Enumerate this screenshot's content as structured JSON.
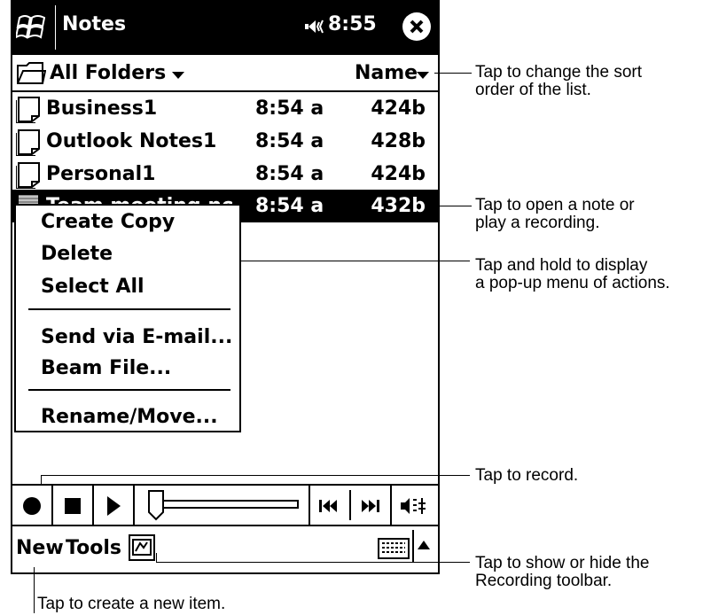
{
  "titlebar": {
    "app_title": "Notes",
    "clock": "8:55",
    "start_icon": "windows-flag-icon",
    "speaker_icon": "speaker-icon",
    "close_icon": "close-icon"
  },
  "folderbar": {
    "folder_label": "All Folders",
    "sort_label": "Name"
  },
  "notes": [
    {
      "name": "Business1",
      "time": "8:54 a",
      "size": "424b",
      "selected": false
    },
    {
      "name": "Outlook Notes1",
      "time": "8:54 a",
      "size": "428b",
      "selected": false
    },
    {
      "name": "Personal1",
      "time": "8:54 a",
      "size": "424b",
      "selected": false
    },
    {
      "name": "Team meeting no",
      "time": "8:54 a",
      "size": "432b",
      "selected": true
    }
  ],
  "context_menu": {
    "items": [
      "Create Copy",
      "Delete",
      "Select All",
      "Send via E-mail...",
      "Beam File...",
      "Rename/Move..."
    ]
  },
  "recording_toolbar": {
    "icons": [
      "record-icon",
      "stop-icon",
      "play-icon",
      "volume-slider",
      "rewind-icon",
      "fast-forward-icon",
      "speaker-settings-icon"
    ]
  },
  "command_bar": {
    "new_label": "New",
    "tools_label": "Tools",
    "keyboard_icon": "keyboard-icon"
  },
  "callouts": {
    "sort": "Tap to change the sort\norder of the list.",
    "open": "Tap to open a note or\nplay a recording.",
    "hold": "Tap and hold to display\na pop-up menu of actions.",
    "record": "Tap to record.",
    "toggle": "Tap to show or hide the\nRecording toolbar.",
    "new": "Tap to create a new item."
  }
}
